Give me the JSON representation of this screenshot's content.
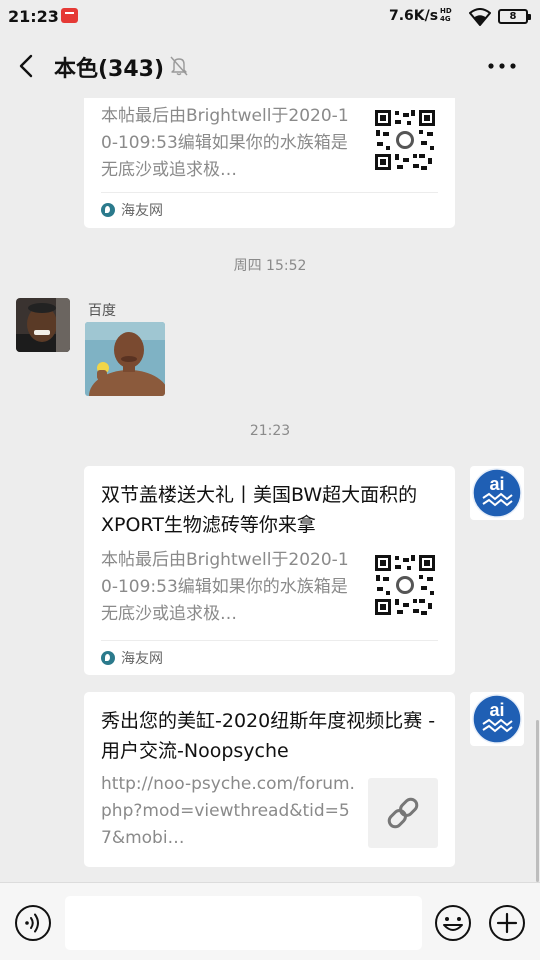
{
  "status_bar": {
    "time": "21:23",
    "net_speed": "7.6K/s",
    "net_type_top": "HD",
    "net_type_bottom": "4G",
    "battery": "8"
  },
  "header": {
    "title": "本色(343)"
  },
  "messages": [
    {
      "kind": "link_card_partial",
      "desc": "本帖最后由Brightwell于2020-10-109:53编辑如果你的水族箱是无底沙或追求极…",
      "source": "海友网"
    },
    {
      "kind": "timestamp",
      "text": "周四 15:52"
    },
    {
      "kind": "image_message",
      "sender": "百度"
    },
    {
      "kind": "timestamp",
      "text": "21:23"
    },
    {
      "kind": "link_card",
      "title": "双节盖楼送大礼丨美国BW超大面积的XPORT生物滤砖等你来拿",
      "desc": "本帖最后由Brightwell于2020-10-109:53编辑如果你的水族箱是无底沙或追求极…",
      "source": "海友网"
    },
    {
      "kind": "link_card",
      "title": "秀出您的美缸-2020纽斯年度视频比赛 - 用户交流-Noopsyche",
      "desc": "http://noo-psyche.com/forum.php?mod=viewthread&tid=57&mobi…"
    }
  ],
  "input": {
    "placeholder": ""
  },
  "colors": {
    "background": "#ededed",
    "card": "#ffffff",
    "avatar_blue": "#1f5fb4"
  }
}
